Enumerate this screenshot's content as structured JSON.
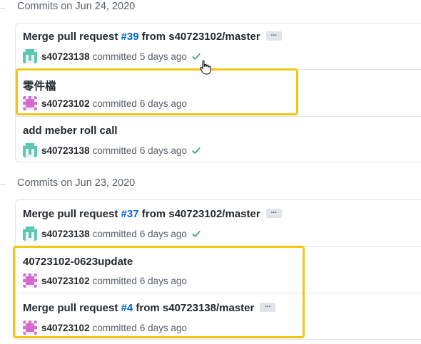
{
  "groups": [
    {
      "heading": "Commits on Jun 24, 2020",
      "commits": [
        {
          "prefix": "Merge pull request ",
          "link": "#39",
          "suffix": " from s40723102/master",
          "has_ellipsis": true,
          "ellipsis": "...",
          "author": "s40723138",
          "verb": "committed",
          "time": "5 days ago",
          "status": "check",
          "avatar": "teal"
        },
        {
          "prefix": "零件檔",
          "link": "",
          "suffix": "",
          "has_ellipsis": false,
          "author": "s40723102",
          "verb": "committed",
          "time": "6 days ago",
          "status": "",
          "avatar": "pink"
        },
        {
          "prefix": "add meber roll call",
          "link": "",
          "suffix": "",
          "has_ellipsis": false,
          "author": "s40723138",
          "verb": "committed",
          "time": "6 days ago",
          "status": "check",
          "avatar": "teal"
        }
      ]
    },
    {
      "heading": "Commits on Jun 23, 2020",
      "commits": [
        {
          "prefix": "Merge pull request ",
          "link": "#37",
          "suffix": " from s40723102/master",
          "has_ellipsis": true,
          "ellipsis": "...",
          "author": "s40723138",
          "verb": "committed",
          "time": "6 days ago",
          "status": "check",
          "avatar": "teal"
        },
        {
          "prefix": "40723102-0623update",
          "link": "",
          "suffix": "",
          "has_ellipsis": false,
          "author": "s40723102",
          "verb": "committed",
          "time": "6 days ago",
          "status": "",
          "avatar": "pink"
        },
        {
          "prefix": "Merge pull request ",
          "link": "#4",
          "suffix": " from s40723138/master",
          "has_ellipsis": true,
          "ellipsis": "...",
          "author": "s40723102",
          "verb": "committed",
          "time": "6 days ago",
          "status": "",
          "avatar": "pink"
        }
      ]
    }
  ],
  "colors": {
    "link": "#0366d6",
    "check": "#28a745",
    "highlight": "#f2c515",
    "avatar_teal": "#5bc7b5",
    "avatar_pink": "#d56bd0"
  }
}
